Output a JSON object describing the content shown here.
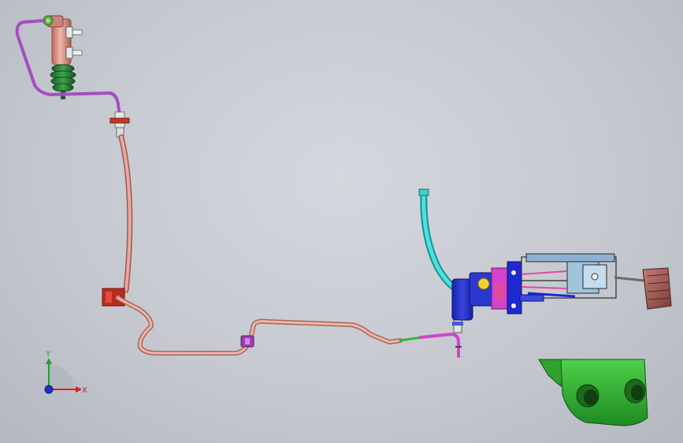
{
  "viewport": {
    "background_top": "#d4d7dd",
    "background_bottom": "#b4b8c0"
  },
  "model": {
    "parts": [
      {
        "name": "clutch-master-cylinder",
        "color": "#d9958a"
      },
      {
        "name": "master-cylinder-boot",
        "color": "#2f8a3e"
      },
      {
        "name": "reservoir-hose",
        "color": "#a24fbd"
      },
      {
        "name": "hydraulic-hose",
        "color": "#d9958a"
      },
      {
        "name": "hose-bracket",
        "color": "#c02a1e"
      },
      {
        "name": "hydraulic-pipe",
        "color": "#e3a194"
      },
      {
        "name": "pipe-clip",
        "color": "#9a3fb8"
      },
      {
        "name": "pipe-connector",
        "color": "#d245c9"
      },
      {
        "name": "green-pipe-segment",
        "color": "#38b53b"
      },
      {
        "name": "vacuum-hose",
        "color": "#39d6d6"
      },
      {
        "name": "brake-booster",
        "color": "#1f2fcf"
      },
      {
        "name": "pedal-bracket",
        "color": "#8fa6bf"
      },
      {
        "name": "pedal-pad",
        "color": "#9c5a55"
      },
      {
        "name": "support-bracket",
        "color": "#2fb32f"
      }
    ]
  },
  "triad": {
    "x_label": "X",
    "y_label": "Y",
    "x_color": "#d62020",
    "y_color": "#20a030",
    "z_color": "#2030d0"
  }
}
